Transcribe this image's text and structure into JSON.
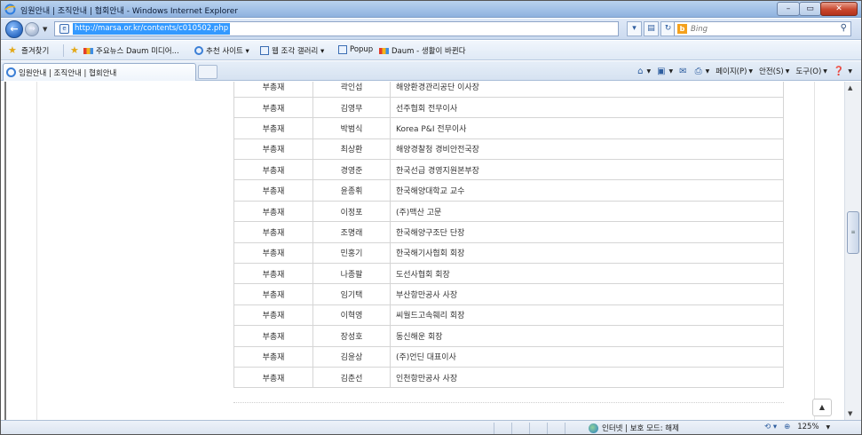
{
  "window": {
    "title": "임원안내 | 조직안내 | 협회안내 - Windows Internet Explorer",
    "controls": {
      "minimize": "–",
      "maximize": "▭",
      "close": "✕"
    }
  },
  "address_bar": {
    "url": "http://marsa.or.kr/contents/c010502.php",
    "search_placeholder": "Bing"
  },
  "favorites_bar": {
    "items": [
      {
        "label": "즐겨찾기",
        "icon": "star-icon"
      },
      {
        "label": "주요뉴스  Daum 미디어...",
        "icon": "news-icon"
      },
      {
        "label": "추천 사이트 ▾",
        "icon": "ie-icon"
      },
      {
        "label": "웹 조각 갤러리 ▾",
        "icon": "page-icon"
      },
      {
        "label": "Popup",
        "icon": "page-icon"
      },
      {
        "label": "Daum - 생활이 바뀐다",
        "icon": "news-icon"
      }
    ]
  },
  "tabs": [
    {
      "label": "임원안내 | 조직안내 | 협회안내"
    }
  ],
  "command_bar": {
    "page": "페이지(P)",
    "safety": "안전(S)",
    "tools": "도구(O)"
  },
  "members": {
    "rows": [
      {
        "position": "부총재",
        "name": "곽인섭",
        "role": "해양환경관리공단 이사장"
      },
      {
        "position": "부총재",
        "name": "김영무",
        "role": "선주협회 전무이사"
      },
      {
        "position": "부총재",
        "name": "박범식",
        "role": "Korea P&I 전무이사"
      },
      {
        "position": "부총재",
        "name": "최상환",
        "role": "해양경찰청 경비안전국장"
      },
      {
        "position": "부총재",
        "name": "경영준",
        "role": "한국선급 경영지원본부장"
      },
      {
        "position": "부총재",
        "name": "윤종휘",
        "role": "한국해양대학교 교수"
      },
      {
        "position": "부총재",
        "name": "이정포",
        "role": "(주)맥산 고문"
      },
      {
        "position": "부총재",
        "name": "조명래",
        "role": "한국해양구조단 단장"
      },
      {
        "position": "부총재",
        "name": "민홍기",
        "role": "한국해기사협회 회장"
      },
      {
        "position": "부총재",
        "name": "나종팔",
        "role": "도선사협회 회장"
      },
      {
        "position": "부총재",
        "name": "임기택",
        "role": "부산항만공사 사장"
      },
      {
        "position": "부총재",
        "name": "이혁영",
        "role": "씨월드고속훼리 회장"
      },
      {
        "position": "부총재",
        "name": "장성호",
        "role": "동신해운 회장"
      },
      {
        "position": "부총재",
        "name": "김윤상",
        "role": "(주)언딘 대표이사"
      },
      {
        "position": "부총재",
        "name": "김춘선",
        "role": "인천항만공사 사장"
      }
    ]
  },
  "status_bar": {
    "zone": "인터넷 | 보호 모드: 해제",
    "zoom": "125%"
  }
}
